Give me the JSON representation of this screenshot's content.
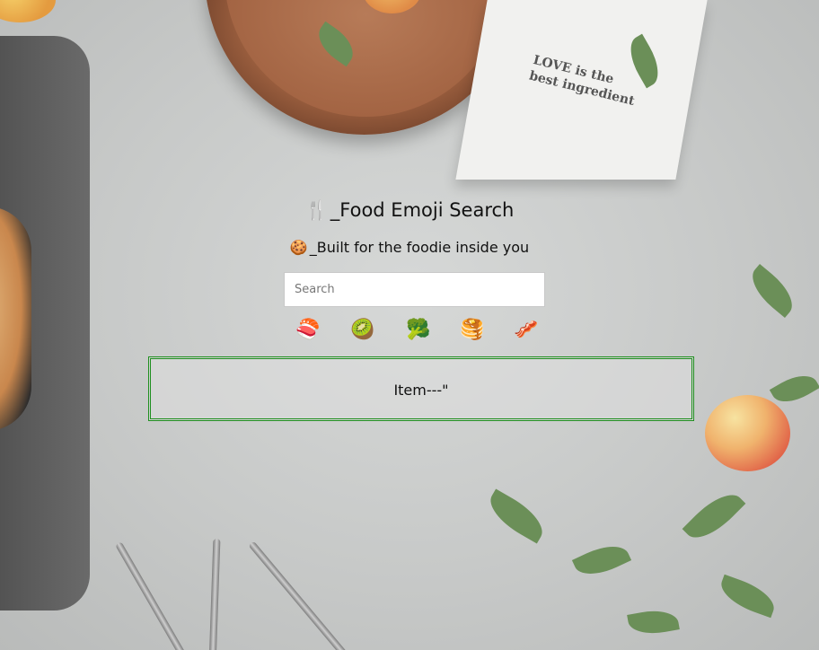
{
  "header": {
    "title_emoji": "🍴",
    "title": "_Food Emoji Search",
    "subtitle_emoji": "🍪",
    "subtitle": "_Built for the foodie inside you"
  },
  "search": {
    "placeholder": "Search",
    "value": ""
  },
  "quick_emojis": [
    {
      "icon": "sushi-icon",
      "glyph": "🍣"
    },
    {
      "icon": "kiwi-icon",
      "glyph": "🥝"
    },
    {
      "icon": "broccoli-icon",
      "glyph": "🥦"
    },
    {
      "icon": "pancakes-icon",
      "glyph": "🥞"
    },
    {
      "icon": "bacon-icon",
      "glyph": "🥓"
    }
  ],
  "results": {
    "item_label": "Item---\""
  },
  "background": {
    "napkin_text_line1": "LOVE is the",
    "napkin_text_line2": "best ingredient"
  },
  "colors": {
    "results_border": "#1f8f1f",
    "text": "#111111"
  }
}
